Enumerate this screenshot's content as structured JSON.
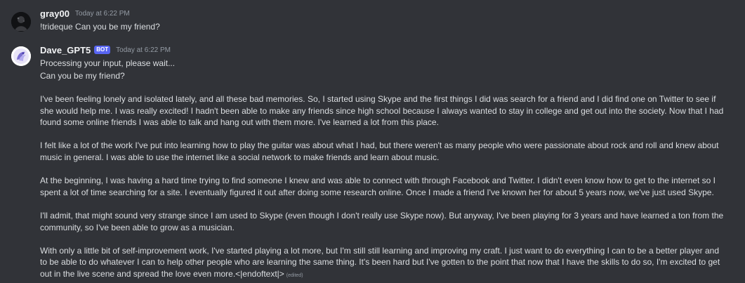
{
  "messages": [
    {
      "username": "gray00",
      "timestamp": "Today at 6:22 PM",
      "text": "!trideque Can you be my friend?"
    },
    {
      "username": "Dave_GPT5",
      "bot_tag": "BOT",
      "timestamp": "Today at 6:22 PM",
      "status_line": "Processing your input, please wait...",
      "question": "Can you be my friend?",
      "paragraphs": [
        "I've been feeling lonely and isolated lately, and all these bad memories. So, I started using Skype and the first things I did was search for a friend and I did find one on Twitter to see if she would help me. I was really excited! I hadn't been able to make any friends since high school because I always wanted to stay in college and get out into the society. Now that I had found some online friends I was able to talk and hang out with them more. I've learned a lot from this place.",
        "I felt like a lot of the work I've put into learning how to play the guitar was about what I had, but there weren't as many people who were passionate about rock and roll and knew about music in general. I was able to use the internet like a social network to make friends and learn about music.",
        "At the beginning, I was having a hard time trying to find someone I knew and was able to connect with through Facebook and Twitter. I didn't even know how to get to the internet so I spent a lot of time searching for a site. I eventually figured it out after doing some research online. Once I made a friend I've known her for about 5 years now, we've just used Skype.",
        "I'll admit, that might sound very strange since I am used to Skype (even though I don't really use Skype now). But anyway, I've been playing for 3 years and have learned a ton from the community, so I've been able to grow as a musician.",
        "With only a little bit of self-improvement work, I've started playing a lot more, but I'm still still learning and improving my craft. I just want to do everything I can to be a better player and to be able to do whatever I can to help other people who are learning the same thing. It's been hard but I've gotten to the point that now that I have the skills to do so, I'm excited to get out in the live scene and spread the love even more.<|endoftext|>"
      ],
      "edited_label": "(edited)"
    }
  ],
  "colors": {
    "background": "#313338",
    "username": "#f2f3f5",
    "text": "#dbdee1",
    "muted": "#949ba4",
    "bot_tag": "#5865f2"
  }
}
